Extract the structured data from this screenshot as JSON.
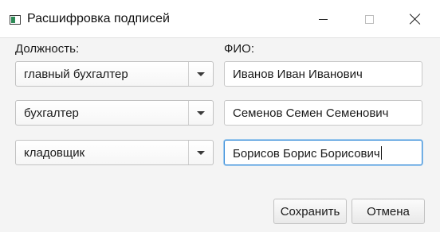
{
  "window": {
    "title": "Расшифровка подписей"
  },
  "labels": {
    "position": "Должность:",
    "full_name": "ФИО:"
  },
  "rows": [
    {
      "position": "главный бухгалтер",
      "name": "Иванов Иван Иванович"
    },
    {
      "position": "бухгалтер",
      "name": "Семенов Семен Семенович"
    },
    {
      "position": "кладовщик",
      "name": "Борисов Борис Борисович"
    }
  ],
  "buttons": {
    "save": "Сохранить",
    "cancel": "Отмена"
  },
  "icons": {
    "app": "app-window-icon",
    "minimize": "minimize-icon",
    "maximize": "maximize-icon",
    "close": "close-icon",
    "dropdown": "chevron-down-icon"
  },
  "colors": {
    "focus_border": "#3d8fd9",
    "background": "#f4f4f4"
  }
}
